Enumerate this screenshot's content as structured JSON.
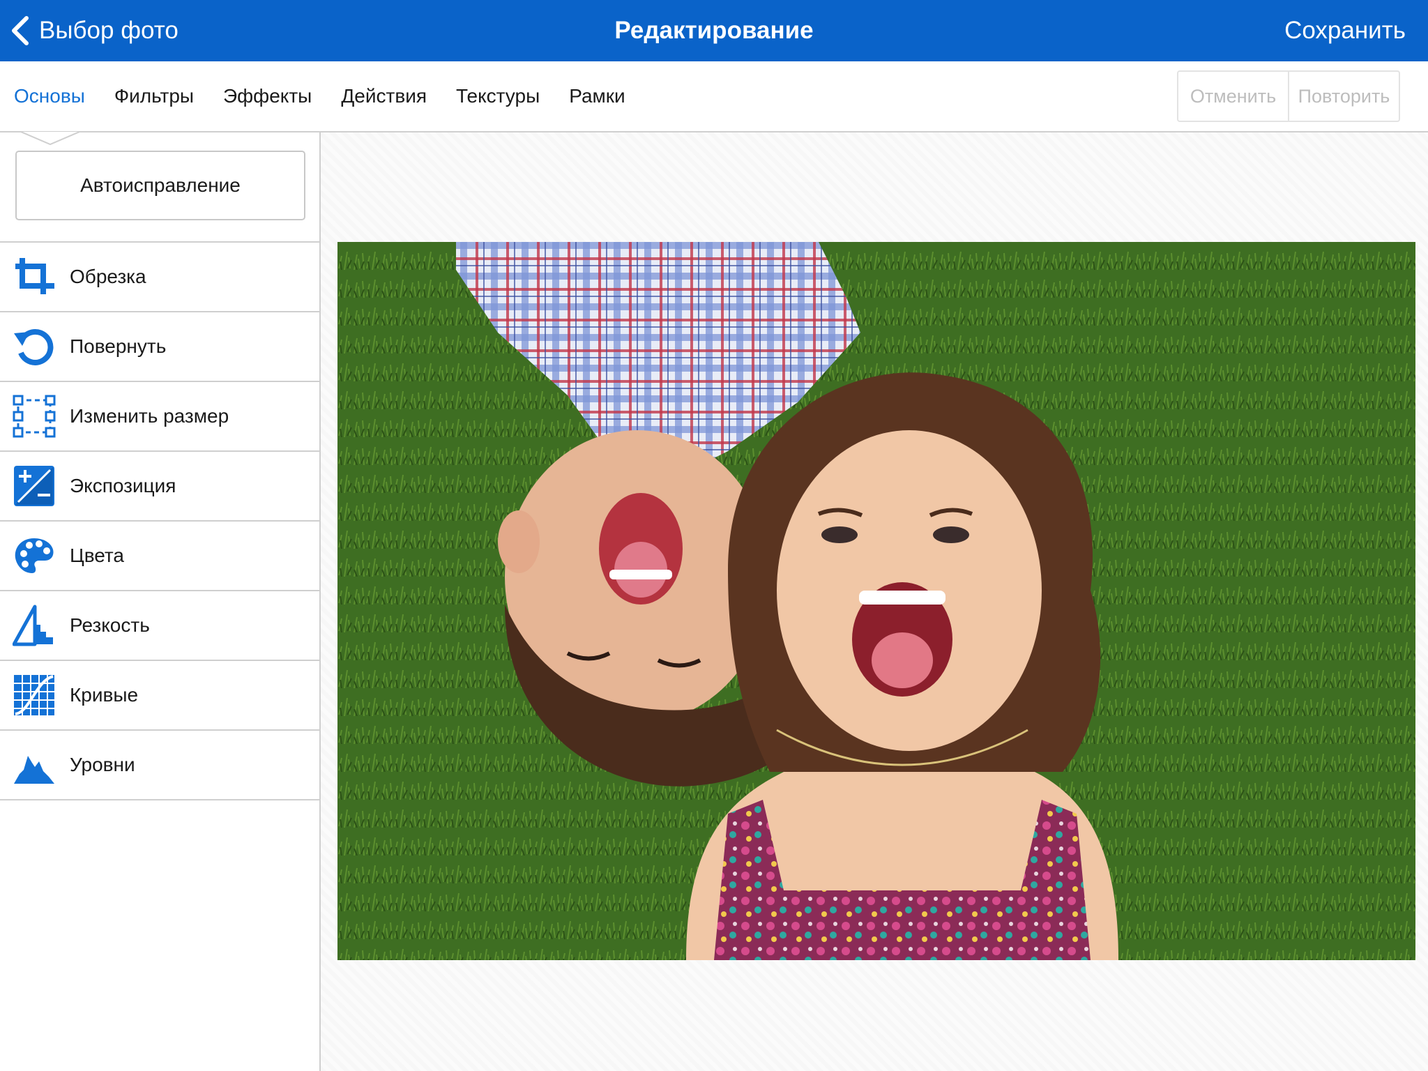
{
  "navbar": {
    "back_label": "Выбор фото",
    "title": "Редактирование",
    "save_label": "Сохранить",
    "color": "#0a63c9"
  },
  "tabs": [
    {
      "label": "Основы",
      "active": true
    },
    {
      "label": "Фильтры",
      "active": false
    },
    {
      "label": "Эффекты",
      "active": false
    },
    {
      "label": "Действия",
      "active": false
    },
    {
      "label": "Текстуры",
      "active": false
    },
    {
      "label": "Рамки",
      "active": false
    }
  ],
  "history": {
    "undo_label": "Отменить",
    "redo_label": "Повторить"
  },
  "panel": {
    "auto_fix_label": "Автоисправление",
    "tools": [
      {
        "label": "Обрезка",
        "icon": "crop-icon"
      },
      {
        "label": "Повернуть",
        "icon": "rotate-icon"
      },
      {
        "label": "Изменить размер",
        "icon": "resize-icon"
      },
      {
        "label": "Экспозиция",
        "icon": "exposure-icon"
      },
      {
        "label": "Цвета",
        "icon": "palette-icon"
      },
      {
        "label": "Резкость",
        "icon": "sharpness-icon"
      },
      {
        "label": "Кривые",
        "icon": "curves-icon"
      },
      {
        "label": "Уровни",
        "icon": "levels-icon"
      }
    ]
  },
  "accent_color": "#1472d6"
}
